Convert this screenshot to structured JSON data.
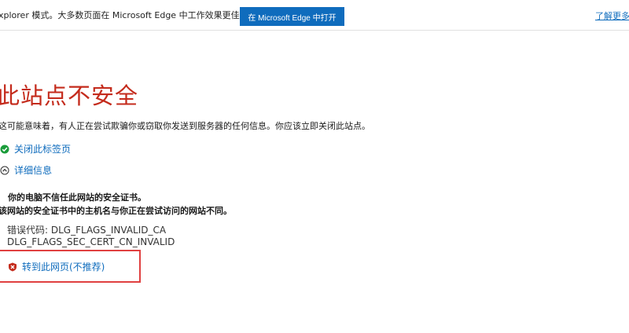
{
  "infobar": {
    "message": "xplorer 模式。大多数页面在 Microsoft Edge 中工作效果更佳。",
    "open_button": "在 Microsoft Edge 中打开",
    "learn_more": "了解更多"
  },
  "page": {
    "title": "此站点不安全",
    "description": "这可能意味着，有人正在尝试欺骗你或窃取你发送到服务器的任何信息。你应该立即关闭此站点。",
    "close_tab": "关闭此标签页",
    "details": "详细信息",
    "cert_untrusted": "你的电脑不信任此网站的安全证书。",
    "cert_mismatch": "该网站的安全证书中的主机名与你正在尝试访问的网站不同。",
    "error_label": "错误代码: DLG_FLAGS_INVALID_CA",
    "error_code2": "DLG_FLAGS_SEC_CERT_CN_INVALID",
    "proceed": "转到此网页(不推荐)"
  },
  "colors": {
    "accent": "#0f6cbd",
    "danger": "#c42b1c",
    "ok": "#1a9c3a",
    "highlight": "#e04040"
  },
  "icons": {
    "close_tab": "green-check-shield-icon",
    "details": "chevron-up-circle-icon",
    "proceed": "red-x-shield-icon"
  }
}
